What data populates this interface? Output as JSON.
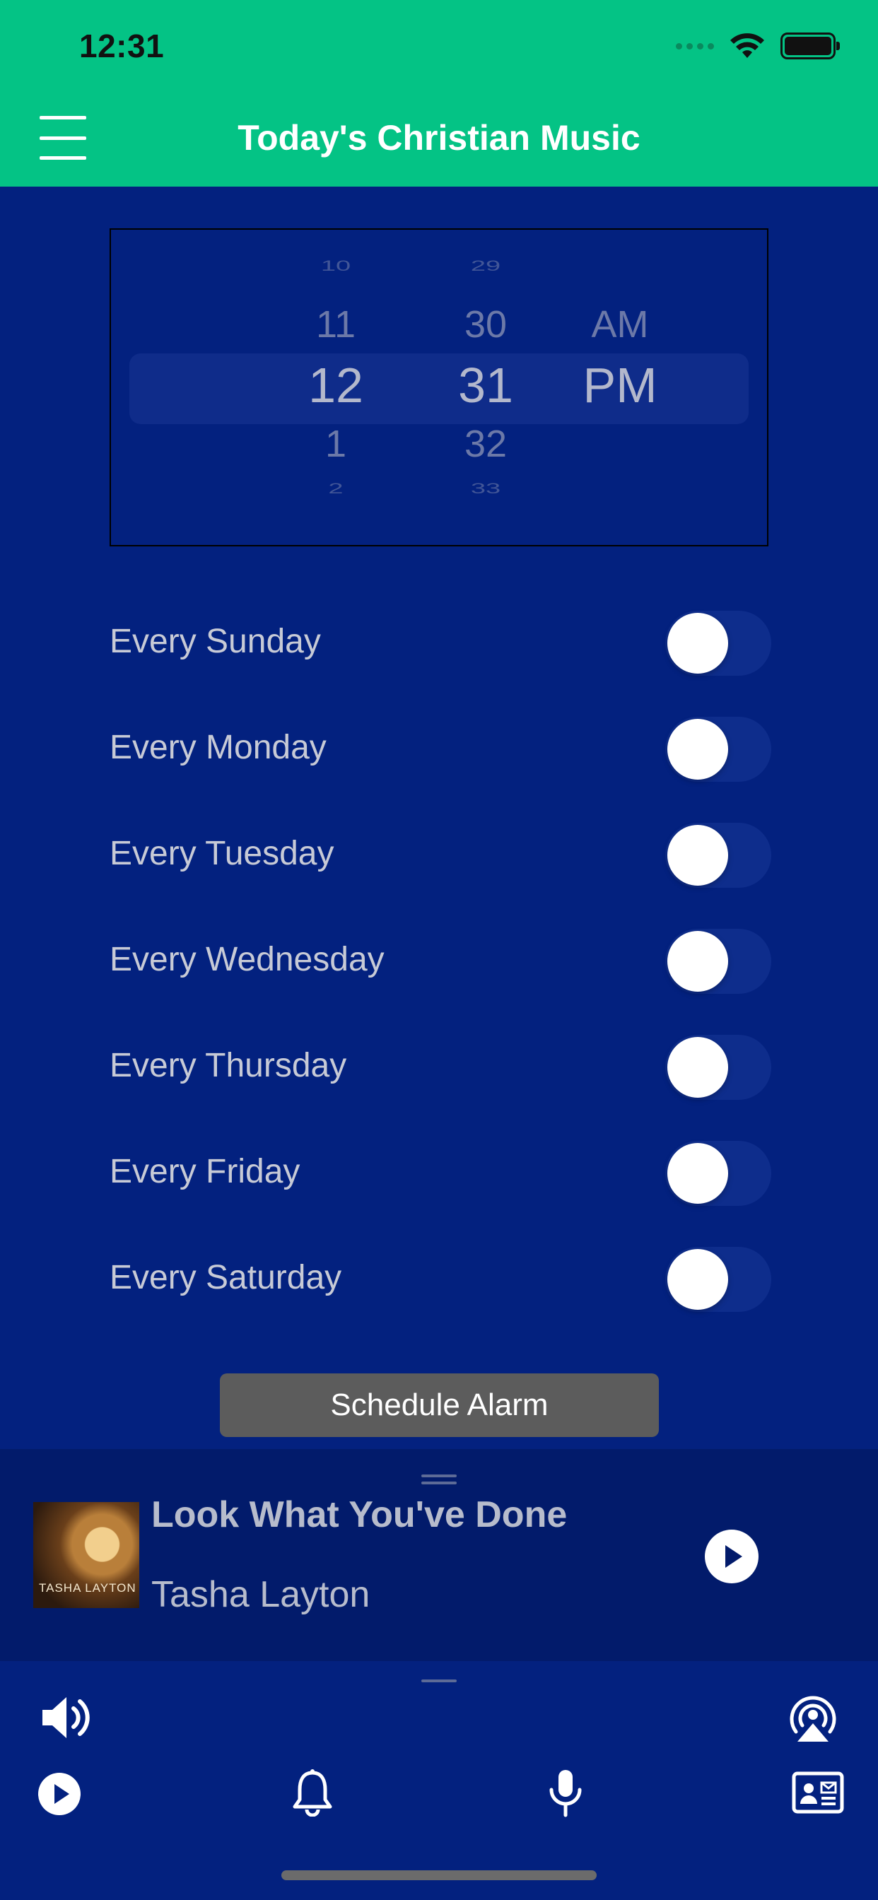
{
  "status_bar": {
    "time": "12:31"
  },
  "header": {
    "title": "Today's Christian Music",
    "menu_icon": "hamburger-menu-icon"
  },
  "time_picker": {
    "hours": [
      "10",
      "11",
      "12",
      "1",
      "2"
    ],
    "minutes": [
      "29",
      "30",
      "31",
      "32",
      "33"
    ],
    "periods": [
      "AM",
      "PM"
    ],
    "selected": {
      "hour": "12",
      "minute": "31",
      "period": "PM"
    }
  },
  "days": [
    {
      "label": "Every Sunday",
      "enabled": false
    },
    {
      "label": "Every Monday",
      "enabled": false
    },
    {
      "label": "Every Tuesday",
      "enabled": false
    },
    {
      "label": "Every Wednesday",
      "enabled": false
    },
    {
      "label": "Every Thursday",
      "enabled": false
    },
    {
      "label": "Every Friday",
      "enabled": false
    },
    {
      "label": "Every Saturday",
      "enabled": false
    }
  ],
  "schedule_button": {
    "label": "Schedule Alarm"
  },
  "now_playing": {
    "title": "Look What You've Done",
    "artist": "Tasha Layton",
    "album_art_text": "TASHA LAYTON",
    "play_icon": "play-circle-icon"
  },
  "bottom_controls": {
    "icons": [
      "volume-icon",
      "airplay-icon",
      "play-icon",
      "bell-icon",
      "microphone-icon",
      "contact-card-icon"
    ]
  },
  "colors": {
    "header": "#04c385",
    "background": "#03217f",
    "now_playing_bg": "#021b6b",
    "button": "#5c5c5c"
  }
}
